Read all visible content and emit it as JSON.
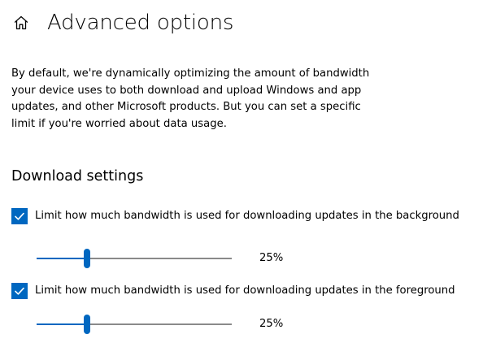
{
  "header": {
    "home_icon": "home-icon",
    "title": "Advanced options"
  },
  "description": "By default, we're dynamically optimizing the amount of bandwidth your device uses to both download and upload Windows and app updates, and other Microsoft products. But you can set a specific limit if you're worried about data usage.",
  "download_settings": {
    "title": "Download settings",
    "background": {
      "checked": true,
      "label": "Limit how much bandwidth is used for downloading updates in the background",
      "slider_fraction": 0.25,
      "value_label": "25%"
    },
    "foreground": {
      "checked": true,
      "label": "Limit how much bandwidth is used for downloading updates in the foreground",
      "slider_fraction": 0.25,
      "value_label": "25%"
    }
  },
  "colors": {
    "accent": "#0067c0",
    "track": "#8a8a8a"
  }
}
